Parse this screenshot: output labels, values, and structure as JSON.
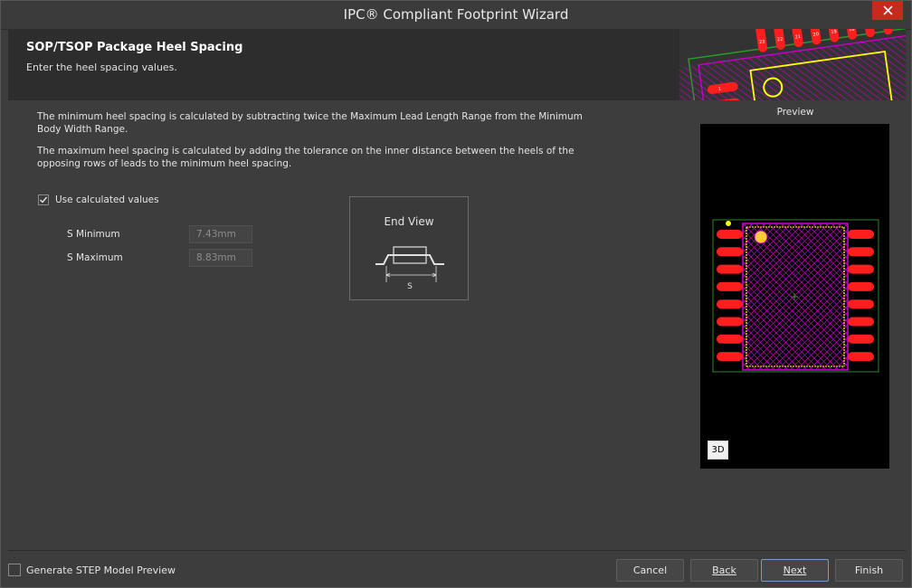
{
  "window": {
    "title": "IPC® Compliant Footprint Wizard"
  },
  "header": {
    "title": "SOP/TSOP Package Heel Spacing",
    "subtitle": "Enter the heel spacing values.",
    "art_pad_labels": [
      "23",
      "22",
      "21",
      "20",
      "19",
      "18",
      "17",
      "16",
      "1",
      "2"
    ]
  },
  "content": {
    "para1": "The minimum heel spacing is calculated by subtracting twice the Maximum Lead Length Range from the Minimum Body Width Range.",
    "para2": "The maximum heel spacing is calculated by adding the tolerance on the inner distance between the heels of the opposing rows of leads to the minimum heel spacing.",
    "use_calculated": {
      "label": "Use calculated values",
      "checked": true
    },
    "fields": [
      {
        "label": "S Minimum",
        "value": "7.43mm"
      },
      {
        "label": "S Maximum",
        "value": "8.83mm"
      }
    ],
    "end_view": {
      "title": "End View",
      "dimension_label": "S"
    }
  },
  "preview": {
    "label": "Preview",
    "button_3d": "3D"
  },
  "footer": {
    "step_preview": {
      "label": "Generate STEP Model Preview",
      "checked": false
    },
    "buttons": {
      "cancel": "Cancel",
      "back": "Back",
      "next": "Next",
      "finish": "Finish"
    }
  },
  "colors": {
    "pad_red": "#ff1e1e",
    "body_magenta": "#c000c0",
    "silk_yellow": "#ffff00",
    "pin1_marker": "#ffcc33",
    "outline_green": "#2a8a2a",
    "close_red": "#c42b1c",
    "accent_border": "#7a9cc4"
  },
  "icons": {
    "close": "close-icon",
    "check": "check-icon"
  }
}
